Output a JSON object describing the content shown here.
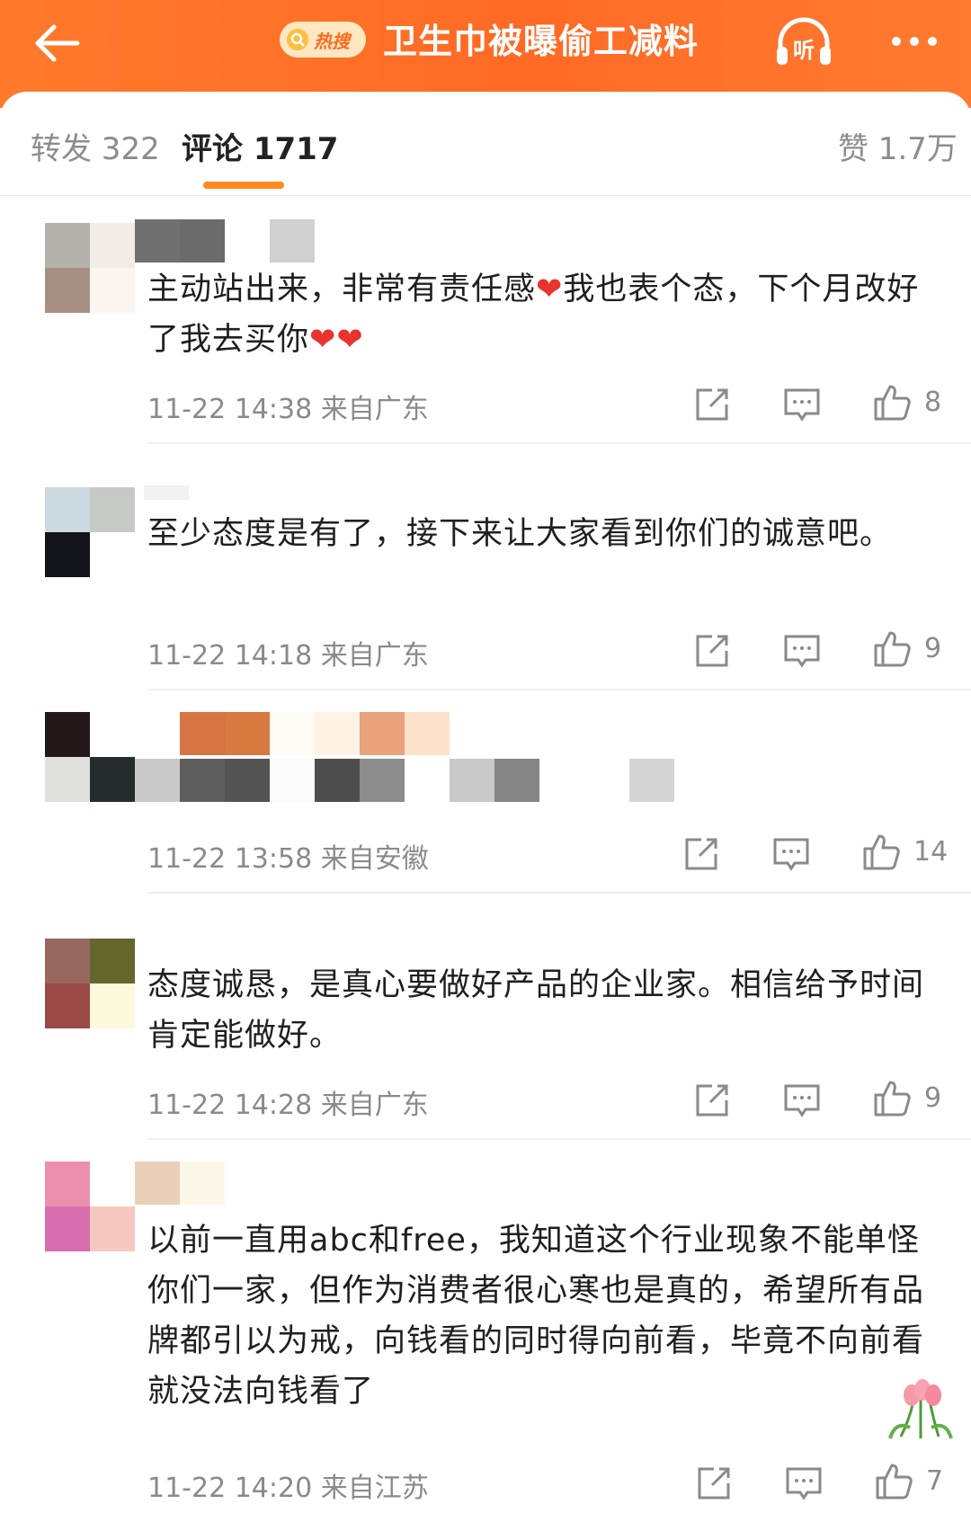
{
  "header": {
    "hot_badge_label": "热搜",
    "topic_title": "卫生巾被曝偷工减料",
    "listen_label": "听"
  },
  "tabs": {
    "repost": "转发 322",
    "comments": "评论 1717",
    "likes": "赞 1.7万"
  },
  "comments": [
    {
      "text": "主动站出来，非常有责任感❤️我也表个态，下个月改好了我去买你❤️❤️",
      "time": "11-22 14:38",
      "location": "来自广东",
      "likes": "8"
    },
    {
      "text": "至少态度是有了，接下来让大家看到你们的诚意吧。",
      "time": "11-22 14:18",
      "location": "来自广东",
      "likes": "9"
    },
    {
      "text": "",
      "time": "11-22 13:58",
      "location": "来自安徽",
      "likes": "14"
    },
    {
      "text": "态度诚恳，是真心要做好产品的企业家。相信给予时间肯定能做好。",
      "time": "11-22 14:28",
      "location": "来自广东",
      "likes": "9"
    },
    {
      "text": "以前一直用abc和free，我知道这个行业现象不能单怪你们一家，但作为消费者很心寒也是真的，希望所有品牌都引以为戒，向钱看的同时得向前看，毕竟不向前看就没法向钱看了",
      "time": "11-22 14:20",
      "location": "来自江苏",
      "likes": "7"
    }
  ],
  "colors": {
    "header_orange": "#ff6a24",
    "tab_underline": "#ff8a1e",
    "meta_gray": "#8a8a8a",
    "heart_red": "#e8332e"
  },
  "icons": [
    "back-arrow-icon",
    "search-icon",
    "headphones-icon",
    "more-dots-icon",
    "share-icon",
    "comment-icon",
    "thumbs-up-icon",
    "tulip-sticker-icon"
  ]
}
